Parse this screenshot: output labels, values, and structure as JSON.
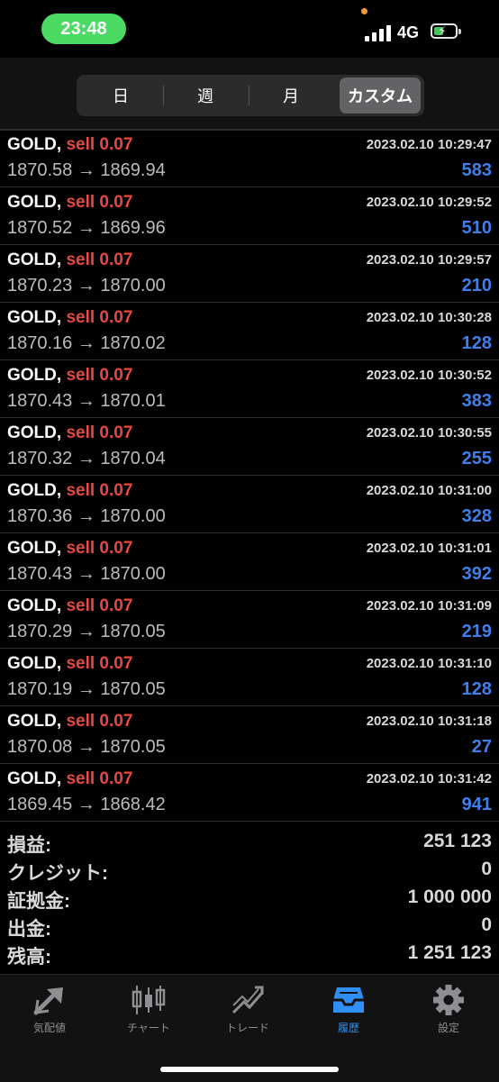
{
  "status": {
    "time": "23:48",
    "network": "4G"
  },
  "segments": [
    {
      "label": "日",
      "active": false
    },
    {
      "label": "週",
      "active": false
    },
    {
      "label": "月",
      "active": false
    },
    {
      "label": "カスタム",
      "active": true
    }
  ],
  "trades": [
    {
      "symbol": "GOLD,",
      "side": "sell 0.07",
      "time": "2023.02.10 10:29:47",
      "open": "1870.58",
      "close": "1869.94",
      "profit": "583"
    },
    {
      "symbol": "GOLD,",
      "side": "sell 0.07",
      "time": "2023.02.10 10:29:52",
      "open": "1870.52",
      "close": "1869.96",
      "profit": "510"
    },
    {
      "symbol": "GOLD,",
      "side": "sell 0.07",
      "time": "2023.02.10 10:29:57",
      "open": "1870.23",
      "close": "1870.00",
      "profit": "210"
    },
    {
      "symbol": "GOLD,",
      "side": "sell 0.07",
      "time": "2023.02.10 10:30:28",
      "open": "1870.16",
      "close": "1870.02",
      "profit": "128"
    },
    {
      "symbol": "GOLD,",
      "side": "sell 0.07",
      "time": "2023.02.10 10:30:52",
      "open": "1870.43",
      "close": "1870.01",
      "profit": "383"
    },
    {
      "symbol": "GOLD,",
      "side": "sell 0.07",
      "time": "2023.02.10 10:30:55",
      "open": "1870.32",
      "close": "1870.04",
      "profit": "255"
    },
    {
      "symbol": "GOLD,",
      "side": "sell 0.07",
      "time": "2023.02.10 10:31:00",
      "open": "1870.36",
      "close": "1870.00",
      "profit": "328"
    },
    {
      "symbol": "GOLD,",
      "side": "sell 0.07",
      "time": "2023.02.10 10:31:01",
      "open": "1870.43",
      "close": "1870.00",
      "profit": "392"
    },
    {
      "symbol": "GOLD,",
      "side": "sell 0.07",
      "time": "2023.02.10 10:31:09",
      "open": "1870.29",
      "close": "1870.05",
      "profit": "219"
    },
    {
      "symbol": "GOLD,",
      "side": "sell 0.07",
      "time": "2023.02.10 10:31:10",
      "open": "1870.19",
      "close": "1870.05",
      "profit": "128"
    },
    {
      "symbol": "GOLD,",
      "side": "sell 0.07",
      "time": "2023.02.10 10:31:18",
      "open": "1870.08",
      "close": "1870.05",
      "profit": "27"
    },
    {
      "symbol": "GOLD,",
      "side": "sell 0.07",
      "time": "2023.02.10 10:31:42",
      "open": "1869.45",
      "close": "1868.42",
      "profit": "941"
    }
  ],
  "arrow": "→",
  "summary": [
    {
      "label": "損益:",
      "value": "251 123"
    },
    {
      "label": "クレジット:",
      "value": "0"
    },
    {
      "label": "証拠金:",
      "value": "1 000 000"
    },
    {
      "label": "出金:",
      "value": "0"
    },
    {
      "label": "残高:",
      "value": "1 251 123"
    }
  ],
  "tabs": [
    {
      "label": "気配値",
      "icon": "quotes-icon",
      "active": false
    },
    {
      "label": "チャート",
      "icon": "candlestick-chart-icon",
      "active": false
    },
    {
      "label": "トレード",
      "icon": "trade-trend-icon",
      "active": false
    },
    {
      "label": "履歴",
      "icon": "history-inbox-icon",
      "active": true
    },
    {
      "label": "設定",
      "icon": "gear-icon",
      "active": false
    }
  ],
  "colors": {
    "sell": "#e8473f",
    "profit": "#3f7fe9",
    "active_tab": "#2f8ff5",
    "time_pill": "#4cd964"
  }
}
